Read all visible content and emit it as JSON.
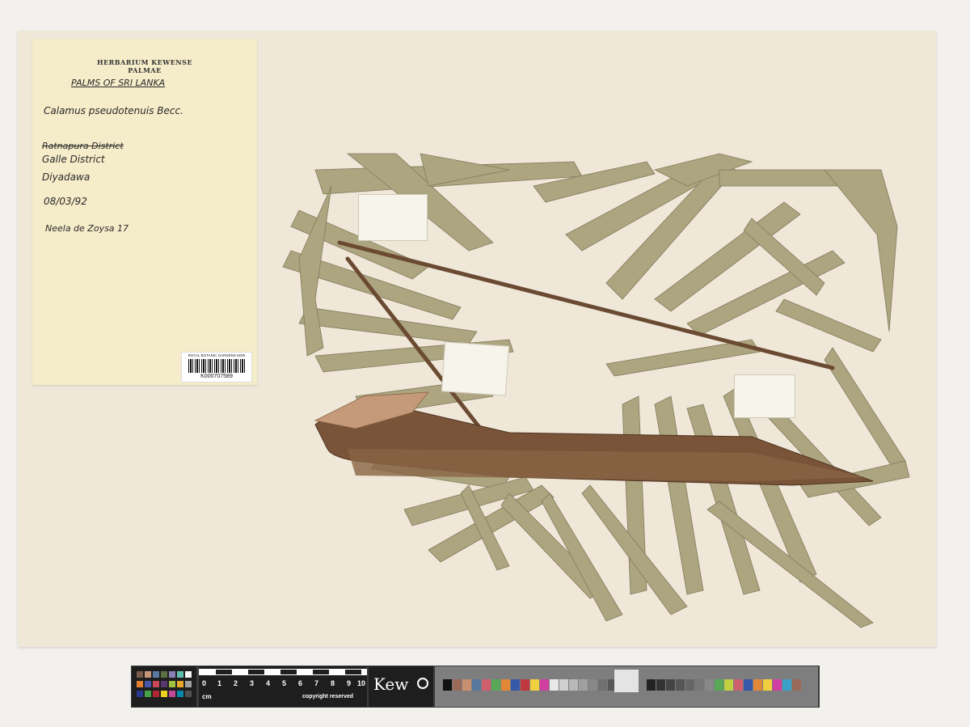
{
  "label": {
    "institution": "HERBARIUM KEWENSE",
    "family": "PALMAE",
    "series": "PALMS OF SRI LANKA",
    "species": "Calamus pseudotenuis Becc.",
    "struck_district": "Ratnapura District",
    "district": "Galle District",
    "locality": "Diyadawa",
    "date": "08/03/92",
    "collector": "Neela de Zoysa 17"
  },
  "barcode": {
    "header": "ROYAL BOTANIC GARDENS KEW",
    "number": "K000707589"
  },
  "scale_bar": {
    "numbers": [
      "0",
      "1",
      "2",
      "3",
      "4",
      "5",
      "6",
      "7",
      "8",
      "9",
      "10"
    ],
    "unit": "cm",
    "copyright": "copyright reserved",
    "brand": "Kew"
  },
  "colors": {
    "sheet": "#efe7d8",
    "label_paper": "#f5ecc9",
    "leaf": "#a8a07a",
    "stem": "#6b4a32"
  }
}
